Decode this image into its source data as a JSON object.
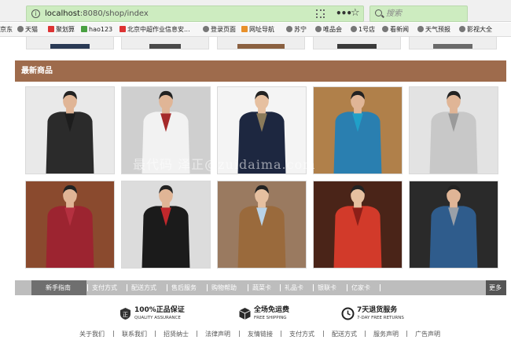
{
  "browser": {
    "url_host": "localhost",
    "url_rest": ":8080/shop/index",
    "search_placeholder": "搜索"
  },
  "bookmarks": [
    {
      "label": "京东",
      "icon": "jd-icon"
    },
    {
      "label": "天猫",
      "icon": "tmall-icon"
    },
    {
      "label": "聚划算",
      "icon": "juhuasuan-icon"
    },
    {
      "label": "hao123",
      "icon": "hao123-icon"
    },
    {
      "label": "北京中超作业信息安...",
      "icon": "bookmark-red-icon"
    },
    {
      "label": "登录页面",
      "icon": "page-icon"
    },
    {
      "label": "网址导航",
      "icon": "nav-icon"
    },
    {
      "label": "苏宁",
      "icon": "suning-icon"
    },
    {
      "label": "唯品会",
      "icon": "vip-icon"
    },
    {
      "label": "1号店",
      "icon": "yhd-icon"
    },
    {
      "label": "看新闻",
      "icon": "news-icon"
    },
    {
      "label": "天气预报",
      "icon": "weather-icon"
    },
    {
      "label": "影视大全",
      "icon": "video-icon"
    }
  ],
  "section": {
    "title": "最新商品"
  },
  "products": [
    {
      "name": "product-1",
      "bg": "#e9e9e9",
      "jacket": "#2b2b2b",
      "accent": "#1d1d1d",
      "pants": "#1c1c1c",
      "skin": "#e0b596"
    },
    {
      "name": "product-2",
      "bg": "#cfcfcf",
      "jacket": "#f2f2f2",
      "accent": "#a52a2a",
      "pants": "#222222",
      "skin": "#e0b596"
    },
    {
      "name": "product-3",
      "bg": "#f4f4f4",
      "jacket": "#1d2740",
      "accent": "#8a7a5a",
      "pants": "#1a1f30",
      "skin": "#e6c0a0"
    },
    {
      "name": "product-4",
      "bg": "#b0804a",
      "jacket": "#2a7fb0",
      "accent": "#20a0c8",
      "pants": "#2c2c2c",
      "skin": "#e0b596"
    },
    {
      "name": "product-5",
      "bg": "#e3e3e3",
      "jacket": "#c8c8c8",
      "accent": "#9a9a9a",
      "pants": "#3a3a3a",
      "skin": "#e0b596"
    },
    {
      "name": "product-6",
      "bg": "#8a4a2e",
      "jacket": "#9c2430",
      "accent": "#b53040",
      "pants": "#ffffff",
      "skin": "#e0b596"
    },
    {
      "name": "product-7",
      "bg": "#dcdcdc",
      "jacket": "#1b1b1b",
      "accent": "#c0282c",
      "pants": "#2a2a2a",
      "skin": "#e0b596"
    },
    {
      "name": "product-8",
      "bg": "#9a7a60",
      "jacket": "#9a6a3c",
      "accent": "#b9d3e8",
      "pants": "#5a4030",
      "skin": "#e6c0a0"
    },
    {
      "name": "product-9",
      "bg": "#4a2418",
      "jacket": "#d23a2a",
      "accent": "#8c1f18",
      "pants": "#2a2a2a",
      "skin": "#e6c0a0"
    },
    {
      "name": "product-10",
      "bg": "#2a2a2a",
      "jacket": "#2f5c8c",
      "accent": "#9aa0a8",
      "pants": "#333333",
      "skin": "#e0b596"
    }
  ],
  "watermark": "最代码 泽正@zuidaima.com",
  "nav": {
    "items": [
      "新手指南",
      "支付方式",
      "配送方式",
      "售后服务",
      "购物帮助",
      "蔬菜卡",
      "礼品卡",
      "银联卡",
      "亿家卡"
    ],
    "more": "更多"
  },
  "promises": [
    {
      "main": "100%正品保证",
      "sub": "QUALITY ASSURANCE",
      "icon": "quality-icon"
    },
    {
      "main": "全场免运费",
      "sub": "FREE SHIPPING",
      "icon": "shipping-box-icon"
    },
    {
      "main": "7天退货服务",
      "sub": "7-DAY FREE RETURNS",
      "icon": "clock-icon"
    }
  ],
  "footer_links": [
    "关于我们",
    "联系我们",
    "招贤纳士",
    "法律声明",
    "友情链接",
    "支付方式",
    "配送方式",
    "服务声明",
    "广告声明"
  ]
}
